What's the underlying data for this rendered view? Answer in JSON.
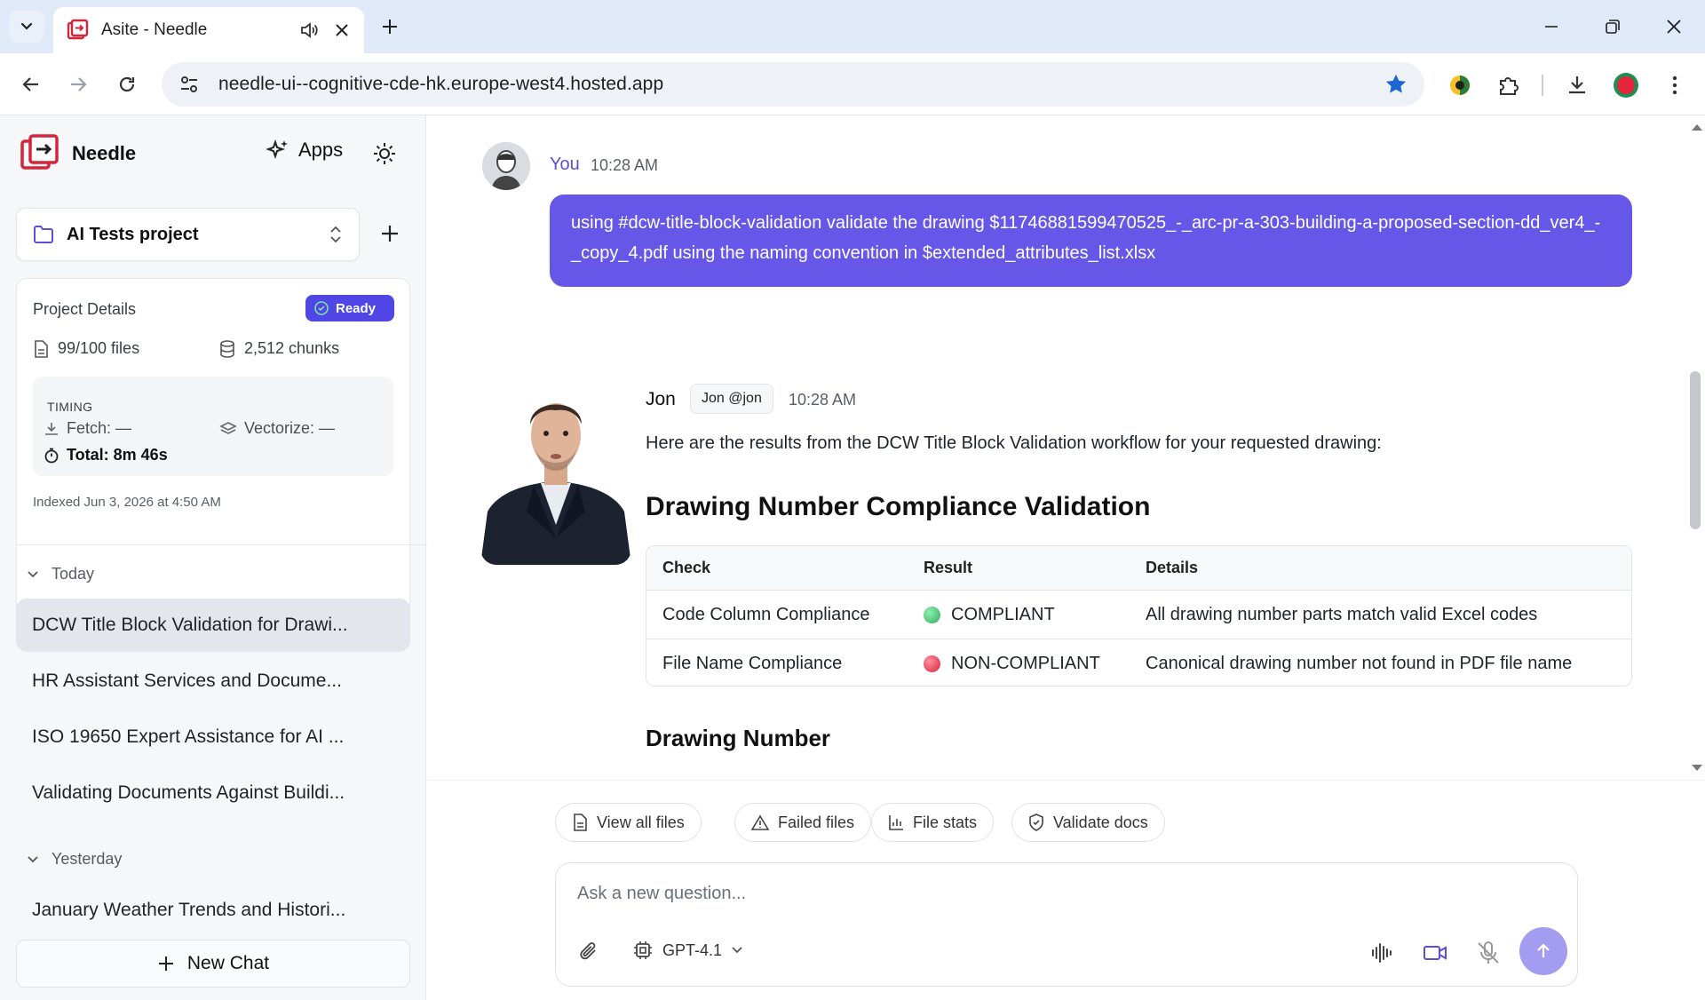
{
  "browser": {
    "tab_title": "Asite - Needle",
    "url": "needle-ui--cognitive-cde-hk.europe-west4.hosted.app"
  },
  "sidebar": {
    "brand": "Needle",
    "apps_label": "Apps",
    "project_name": "AI Tests project",
    "details": {
      "title": "Project Details",
      "status": "Ready",
      "files": "99/100 files",
      "chunks": "2,512 chunks",
      "timing_label": "TIMING",
      "fetch": "Fetch: —",
      "vectorize": "Vectorize: —",
      "total": "Total: 8m 46s",
      "indexed": "Indexed Jun 3, 2026 at 4:50 AM"
    },
    "groups": [
      {
        "label": "Today",
        "items": [
          "DCW Title Block Validation for Drawi...",
          "HR Assistant Services and Docume...",
          "ISO 19650 Expert Assistance for AI ...",
          "Validating Documents Against Buildi..."
        ]
      },
      {
        "label": "Yesterday",
        "items": [
          "January Weather Trends and Histori..."
        ]
      }
    ],
    "new_chat_label": "New Chat"
  },
  "chat": {
    "user": {
      "name": "You",
      "time": "10:28 AM",
      "message": "using #dcw-title-block-validation validate the drawing $11746881599470525_-_arc-pr-a-303-building-a-proposed-section-dd_ver4_-_copy_4.pdf using the naming convention in $extended_attributes_list.xlsx"
    },
    "assistant": {
      "name": "Jon",
      "handle": "Jon @jon",
      "time": "10:28 AM",
      "intro": "Here are the results from the DCW Title Block Validation workflow for your requested drawing:",
      "heading": "Drawing Number Compliance Validation",
      "table": {
        "headers": [
          "Check",
          "Result",
          "Details"
        ],
        "rows": [
          {
            "check": "Code Column Compliance",
            "result": "COMPLIANT",
            "status_color": "#3fbf6e",
            "details": "All drawing number parts match valid Excel codes"
          },
          {
            "check": "File Name Compliance",
            "result": "NON-COMPLIANT",
            "status_color": "#e0334f",
            "details": "Canonical drawing number not found in PDF file name"
          }
        ]
      },
      "subheading": "Drawing Number"
    }
  },
  "quick_actions": [
    "View all files",
    "Failed files",
    "File stats",
    "Validate docs"
  ],
  "composer": {
    "placeholder": "Ask a new question...",
    "model": "GPT-4.1"
  },
  "colors": {
    "accent": "#6657e8",
    "badge": "#4f46e5",
    "logo_red": "#d6243a"
  }
}
